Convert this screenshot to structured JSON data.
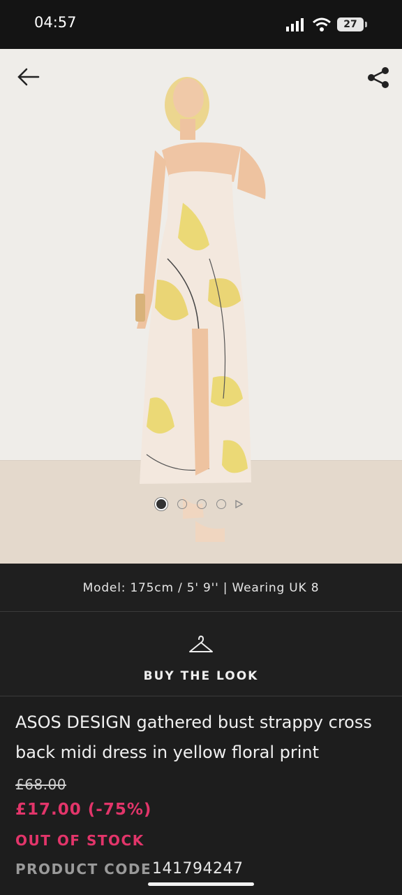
{
  "status_bar": {
    "time": "04:57",
    "battery": "27"
  },
  "product_image": {
    "model_info": "Model: 175cm / 5' 9'' | Wearing UK 8",
    "page_indicator": {
      "count": 5,
      "active_index": 0
    }
  },
  "buy_the_look": {
    "label": "BUY THE LOOK"
  },
  "product": {
    "title": "ASOS DESIGN gathered bust strappy cross back midi dress in yellow floral print",
    "original_price": "£68.00",
    "sale_price": "£17.00 (-75%)",
    "stock_status": "OUT OF STOCK",
    "product_code_label": "PRODUCT CODE",
    "product_code": "141794247"
  },
  "colors": {
    "sale": "#e2356a",
    "background": "#1d1d1d"
  }
}
